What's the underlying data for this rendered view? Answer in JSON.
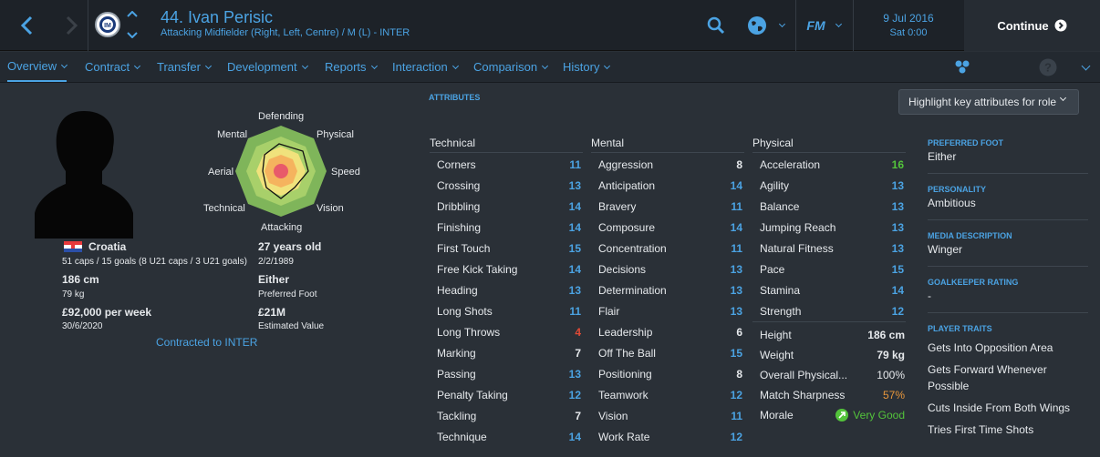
{
  "header": {
    "player_name": "44. Ivan Perisic",
    "player_desc": "Attacking Midfielder (Right, Left, Centre) / M (L) - INTER",
    "date": "9 Jul 2016",
    "time": "Sat 0:00",
    "continue_label": "Continue",
    "fm_logo": "FM"
  },
  "tabs": [
    {
      "label": "Overview",
      "active": true
    },
    {
      "label": "Contract"
    },
    {
      "label": "Transfer"
    },
    {
      "label": "Development"
    },
    {
      "label": "Reports"
    },
    {
      "label": "Interaction"
    },
    {
      "label": "Comparison"
    },
    {
      "label": "History"
    }
  ],
  "radar": {
    "labels": [
      "Defending",
      "Physical",
      "Speed",
      "Vision",
      "Attacking",
      "Technical",
      "Aerial",
      "Mental"
    ]
  },
  "profile": {
    "nationality": "Croatia",
    "caps": "51 caps / 15 goals (8 U21 caps / 3 U21 goals)",
    "age": "27 years old",
    "dob": "2/2/1989",
    "height": "186 cm",
    "weight": "79 kg",
    "foot": "Either",
    "foot_label": "Preferred Foot",
    "wage": "£92,000 per week",
    "contract_end": "30/6/2020",
    "value": "£21M",
    "value_label": "Estimated Value",
    "contracted": "Contracted to INTER"
  },
  "attributes": {
    "header": "ATTRIBUTES",
    "highlight_label": "Highlight key attributes for role",
    "technical_title": "Technical",
    "mental_title": "Mental",
    "physical_title": "Physical",
    "technical": [
      {
        "name": "Corners",
        "value": "11"
      },
      {
        "name": "Crossing",
        "value": "13"
      },
      {
        "name": "Dribbling",
        "value": "14"
      },
      {
        "name": "Finishing",
        "value": "14"
      },
      {
        "name": "First Touch",
        "value": "15"
      },
      {
        "name": "Free Kick Taking",
        "value": "14"
      },
      {
        "name": "Heading",
        "value": "13"
      },
      {
        "name": "Long Shots",
        "value": "11"
      },
      {
        "name": "Long Throws",
        "value": "4"
      },
      {
        "name": "Marking",
        "value": "7"
      },
      {
        "name": "Passing",
        "value": "13"
      },
      {
        "name": "Penalty Taking",
        "value": "12"
      },
      {
        "name": "Tackling",
        "value": "7"
      },
      {
        "name": "Technique",
        "value": "14"
      }
    ],
    "mental": [
      {
        "name": "Aggression",
        "value": "8"
      },
      {
        "name": "Anticipation",
        "value": "14"
      },
      {
        "name": "Bravery",
        "value": "11"
      },
      {
        "name": "Composure",
        "value": "14"
      },
      {
        "name": "Concentration",
        "value": "11"
      },
      {
        "name": "Decisions",
        "value": "13"
      },
      {
        "name": "Determination",
        "value": "13"
      },
      {
        "name": "Flair",
        "value": "13"
      },
      {
        "name": "Leadership",
        "value": "6"
      },
      {
        "name": "Off The Ball",
        "value": "15"
      },
      {
        "name": "Positioning",
        "value": "8"
      },
      {
        "name": "Teamwork",
        "value": "12"
      },
      {
        "name": "Vision",
        "value": "11"
      },
      {
        "name": "Work Rate",
        "value": "12"
      }
    ],
    "physical": [
      {
        "name": "Acceleration",
        "value": "16"
      },
      {
        "name": "Agility",
        "value": "13"
      },
      {
        "name": "Balance",
        "value": "13"
      },
      {
        "name": "Jumping Reach",
        "value": "13"
      },
      {
        "name": "Natural Fitness",
        "value": "13"
      },
      {
        "name": "Pace",
        "value": "15"
      },
      {
        "name": "Stamina",
        "value": "14"
      },
      {
        "name": "Strength",
        "value": "12"
      }
    ],
    "physical_extra": [
      {
        "name": "Height",
        "value": "186 cm"
      },
      {
        "name": "Weight",
        "value": "79 kg"
      },
      {
        "name": "Overall Physical...",
        "value": "100%"
      },
      {
        "name": "Match Sharpness",
        "value": "57%"
      },
      {
        "name": "Morale",
        "value": "Very Good"
      }
    ]
  },
  "side": {
    "preferred_foot_label": "PREFERRED FOOT",
    "preferred_foot": "Either",
    "personality_label": "PERSONALITY",
    "personality": "Ambitious",
    "media_label": "MEDIA DESCRIPTION",
    "media": "Winger",
    "gk_label": "GOALKEEPER RATING",
    "gk": "-",
    "traits_label": "PLAYER TRAITS",
    "traits": [
      "Gets Into Opposition Area",
      "Gets Forward Whenever Possible",
      "Cuts Inside From Both Wings",
      "Tries First Time Shots"
    ]
  },
  "colors": {
    "accent": "#4ba3e3",
    "high": "#53c33b",
    "low": "#e04a36",
    "warn": "#e8973c"
  }
}
